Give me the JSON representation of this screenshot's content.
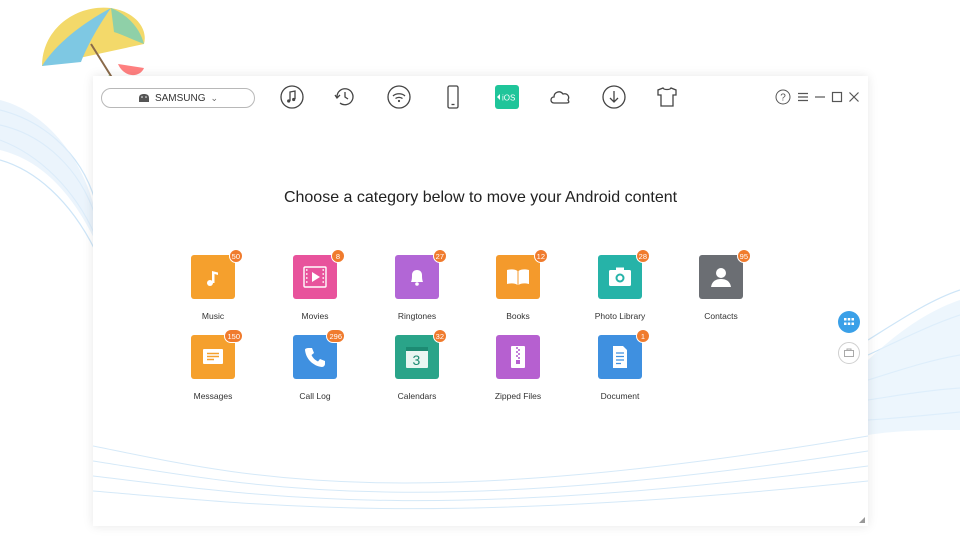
{
  "device": {
    "name": "SAMSUNG",
    "icon": "android-icon"
  },
  "toolbar": [
    {
      "name": "music-tool",
      "icon": "music-note-icon"
    },
    {
      "name": "history-tool",
      "icon": "history-icon"
    },
    {
      "name": "wifi-tool",
      "icon": "wifi-icon"
    },
    {
      "name": "phone-tool",
      "icon": "phone-icon"
    },
    {
      "name": "ios-tool",
      "icon": "ios-transfer-icon",
      "label": "iOS",
      "active": true
    },
    {
      "name": "cloud-tool",
      "icon": "cloud-icon"
    },
    {
      "name": "download-tool",
      "icon": "download-icon"
    },
    {
      "name": "tshirt-tool",
      "icon": "tshirt-icon"
    }
  ],
  "heading": "Choose a category below to move your Android content",
  "categories": [
    {
      "label": "Music",
      "count": "50",
      "color": "#f5a02d",
      "icon": "music-icon"
    },
    {
      "label": "Movies",
      "count": "8",
      "color": "#e8539c",
      "icon": "movie-icon"
    },
    {
      "label": "Ringtones",
      "count": "27",
      "color": "#b266d6",
      "icon": "bell-icon"
    },
    {
      "label": "Books",
      "count": "12",
      "color": "#f49a2c",
      "icon": "book-icon"
    },
    {
      "label": "Photo Library",
      "count": "28",
      "color": "#26b3a8",
      "icon": "camera-icon"
    },
    {
      "label": "Contacts",
      "count": "95",
      "color": "#6b6e73",
      "icon": "person-icon"
    },
    {
      "label": "Messages",
      "count": "150",
      "color": "#f5a02d",
      "icon": "message-icon"
    },
    {
      "label": "Call Log",
      "count": "296",
      "color": "#3f90e0",
      "icon": "phone-call-icon"
    },
    {
      "label": "Calendars",
      "count": "32",
      "color": "#2aa489",
      "icon": "calendar-icon",
      "day": "3"
    },
    {
      "label": "Zipped Files",
      "count": "",
      "color": "#b660d0",
      "icon": "zip-icon"
    },
    {
      "label": "Document",
      "count": "1",
      "color": "#3f90e0",
      "icon": "document-icon"
    }
  ],
  "colors": {
    "accent": "#3aa0e8",
    "badge": "#f07b2d",
    "ios": "#1fc59a"
  }
}
